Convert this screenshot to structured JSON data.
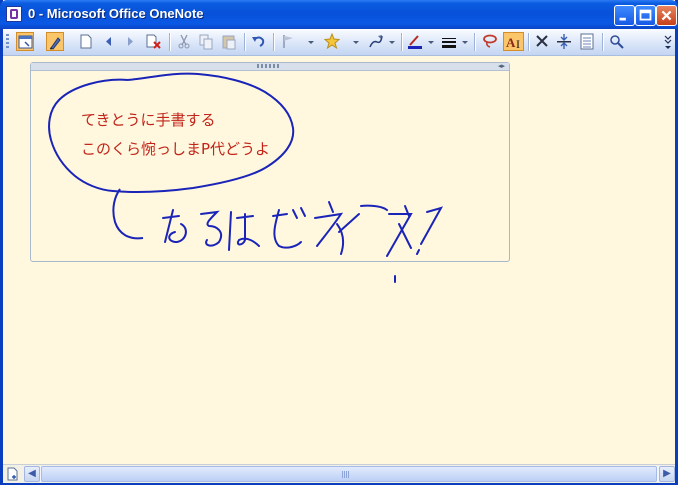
{
  "window": {
    "title": "0 - Microsoft Office OneNote"
  },
  "title_buttons": {
    "minimize": "minimize",
    "maximize": "maximize",
    "close": "close"
  },
  "toolbar": {
    "tools": [
      {
        "icon": "full-page-view-icon",
        "name": "full-page-view"
      },
      {
        "icon": "pen-icon",
        "name": "pen",
        "active": true
      },
      {
        "icon": "new-page-icon",
        "name": "new-page"
      },
      {
        "icon": "back-icon",
        "name": "back"
      },
      {
        "icon": "forward-icon",
        "name": "forward"
      },
      {
        "icon": "delete-page-icon",
        "name": "delete-page"
      },
      {
        "icon": "cut-icon",
        "name": "cut"
      },
      {
        "icon": "copy-icon",
        "name": "copy"
      },
      {
        "icon": "paste-icon",
        "name": "paste"
      },
      {
        "icon": "undo-icon",
        "name": "undo"
      },
      {
        "icon": "flag-icon",
        "name": "note-flag"
      },
      {
        "icon": "star-icon",
        "name": "star-flag"
      },
      {
        "icon": "pen-style-icon",
        "name": "pen-style"
      },
      {
        "icon": "font-color-icon",
        "name": "font-color"
      },
      {
        "icon": "line-weight-icon",
        "name": "line-weight"
      },
      {
        "icon": "lasso-icon",
        "name": "lasso-select"
      },
      {
        "icon": "ink-to-text-icon",
        "name": "ink-to-text",
        "active": true
      },
      {
        "icon": "eraser-icon",
        "name": "eraser"
      },
      {
        "icon": "insert-space-icon",
        "name": "insert-space"
      },
      {
        "icon": "rule-lines-icon",
        "name": "rule-lines"
      },
      {
        "icon": "research-icon",
        "name": "research"
      }
    ]
  },
  "note": {
    "line1": "てきとうに手書する",
    "line2": "このくら惋っしまP代どうよ"
  },
  "handwriting": {
    "text": "なるほどネ!"
  },
  "colors": {
    "ink_blue": "#1a24b8",
    "text_red": "#c2241a",
    "page_bg": "#fff8de",
    "titlebar": "#0851d9"
  }
}
